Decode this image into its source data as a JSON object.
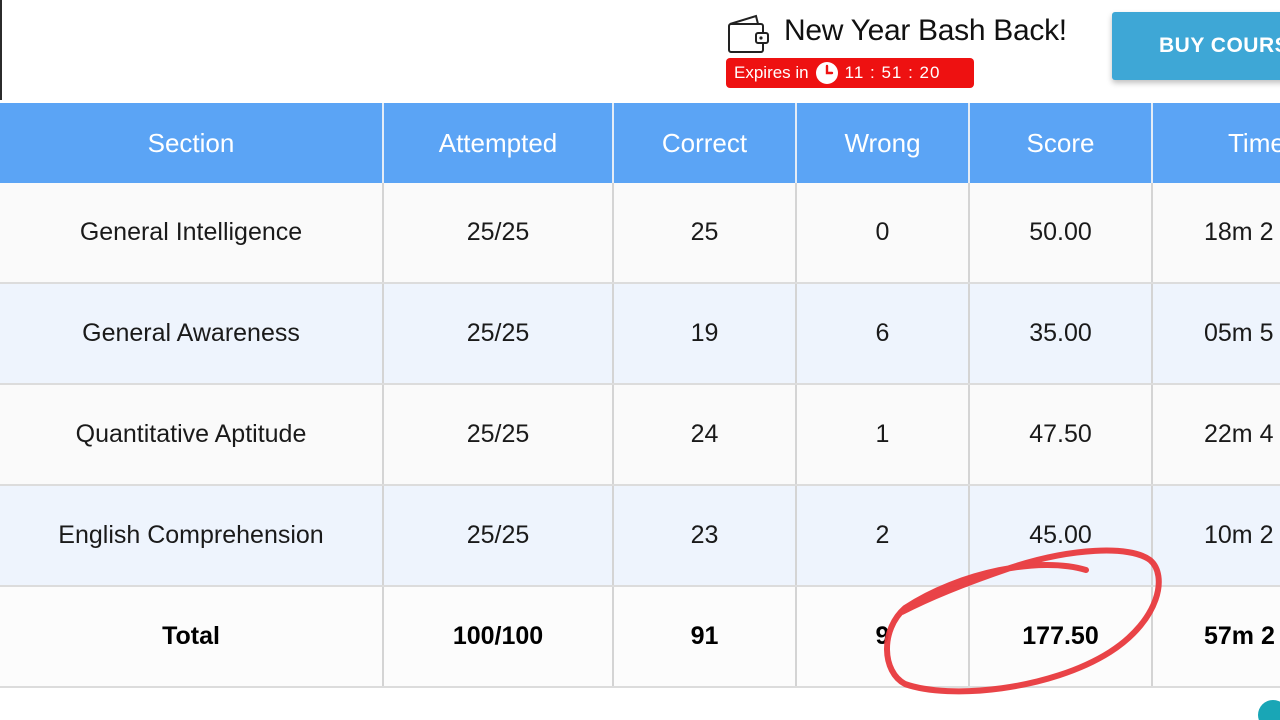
{
  "promo": {
    "title": "New Year Bash Back!",
    "expires_label": "Expires in",
    "timer": "11 : 51 : 20",
    "buy_button_label": "BUY COURSE",
    "badge_color": "#ee1111",
    "button_color": "#3ea7d6"
  },
  "table": {
    "header_color": "#5ba4f5",
    "columns": [
      "Section",
      "Attempted",
      "Correct",
      "Wrong",
      "Score",
      "Time"
    ],
    "rows": [
      [
        "General Intelligence",
        "25/25",
        "25",
        "0",
        "50.00",
        "18m 2"
      ],
      [
        "General Awareness",
        "25/25",
        "19",
        "6",
        "35.00",
        "05m 5"
      ],
      [
        "Quantitative Aptitude",
        "25/25",
        "24",
        "1",
        "47.50",
        "22m 4"
      ],
      [
        "English Comprehension",
        "25/25",
        "23",
        "2",
        "45.00",
        "10m 2"
      ]
    ],
    "total": [
      "Total",
      "100/100",
      "91",
      "9",
      "177.50",
      "57m 2"
    ]
  },
  "icons": {
    "wallet": "wallet-icon",
    "clock": "clock-icon"
  },
  "annotation": {
    "type": "hand-drawn circle",
    "color": "#e8393d"
  }
}
